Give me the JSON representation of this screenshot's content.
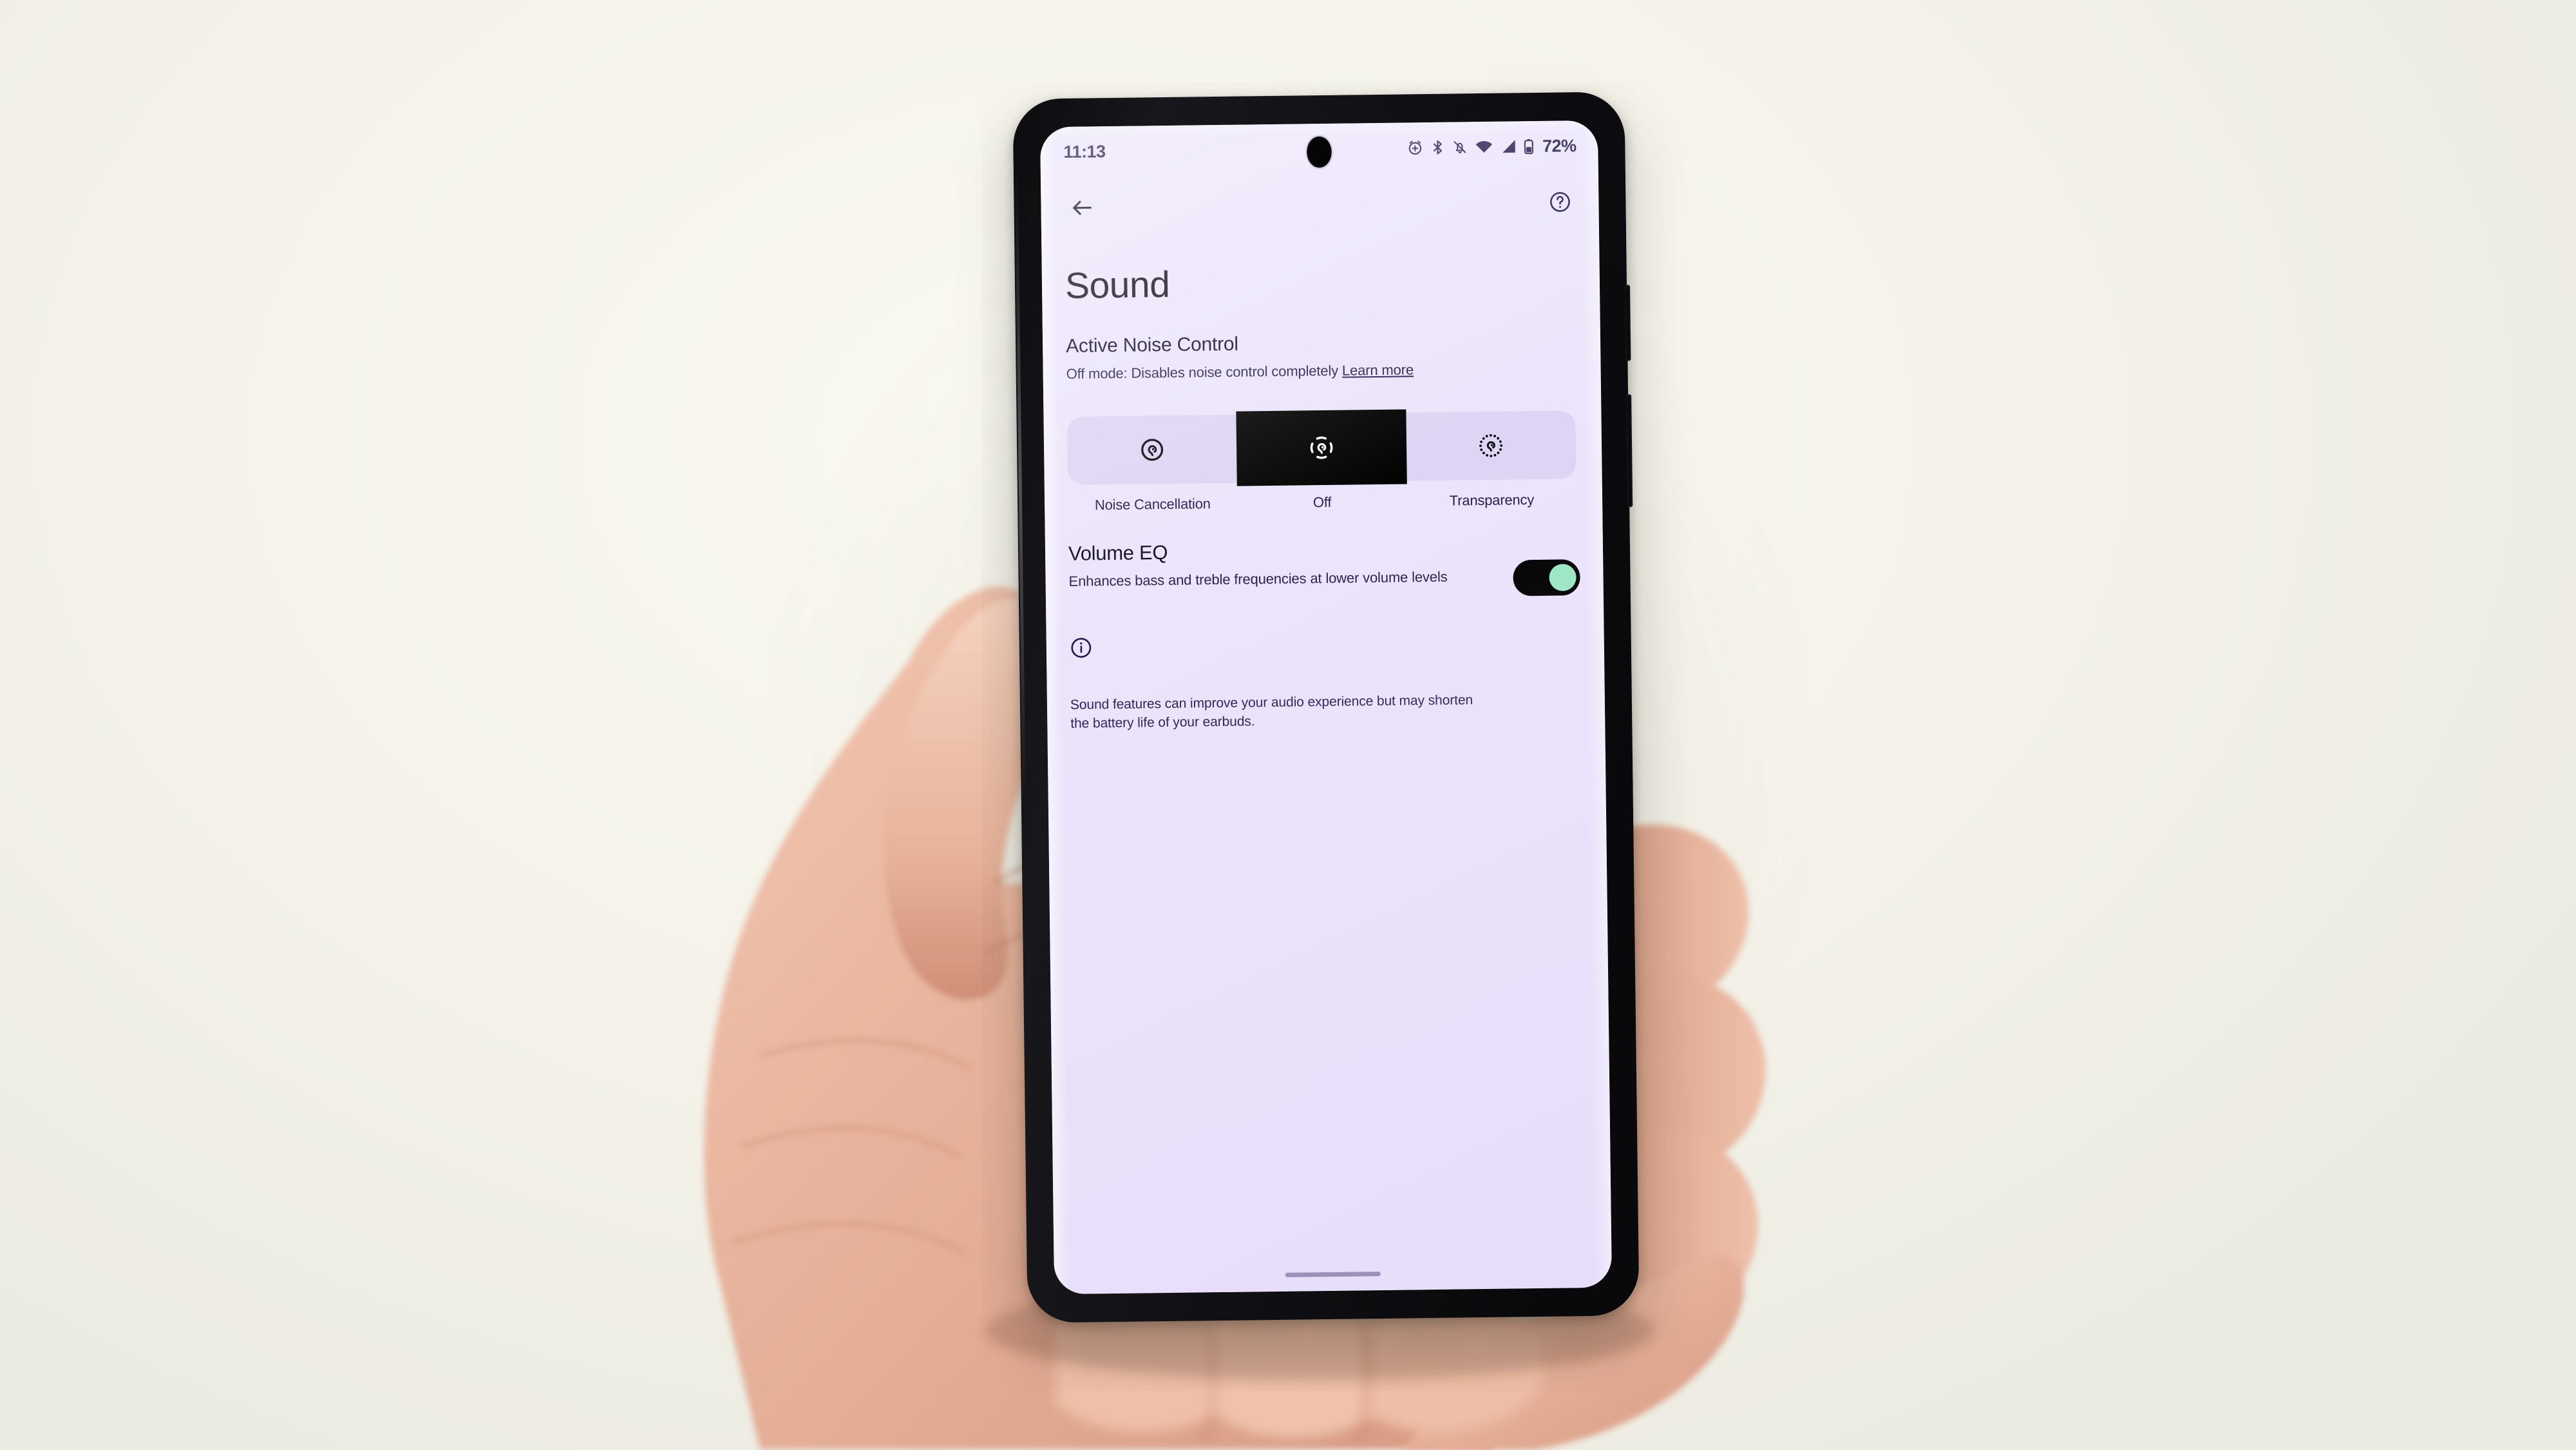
{
  "scene": {
    "background_color": "#f4f2e9",
    "device_body_color": "#101014",
    "screen_background": "#ece4fb"
  },
  "status_bar": {
    "clock": "11:13",
    "battery_percent": "72%",
    "icons": [
      "alarm-plus-icon",
      "bluetooth-icon",
      "notifications-silenced-icon",
      "wifi-icon",
      "cellular-signal-icon",
      "battery-icon"
    ]
  },
  "app_bar": {
    "back_label": "Back",
    "help_label": "Help"
  },
  "page": {
    "title": "Sound"
  },
  "active_noise_control": {
    "heading": "Active Noise Control",
    "description": "Off mode: Disables noise control completely",
    "learn_more": "Learn more",
    "selected_index": 1,
    "options": [
      {
        "label": "Noise Cancellation",
        "icon": "ear-solid-ring-icon",
        "selected": false
      },
      {
        "label": "Off",
        "icon": "ear-dashed-ring-icon",
        "selected": true
      },
      {
        "label": "Transparency",
        "icon": "ear-dotted-ring-icon",
        "selected": false
      }
    ]
  },
  "volume_eq": {
    "title": "Volume EQ",
    "description": "Enhances bass and treble frequencies at lower volume levels",
    "toggle_state": "on",
    "toggle_track_color": "#000000",
    "toggle_thumb_color": "#9ce8c4"
  },
  "info": {
    "icon": "info-circle-icon",
    "note": "Sound features can improve your audio experience but may shorten the battery life of your earbuds."
  },
  "navigation": {
    "gesture_bar": "home-gesture-bar"
  }
}
